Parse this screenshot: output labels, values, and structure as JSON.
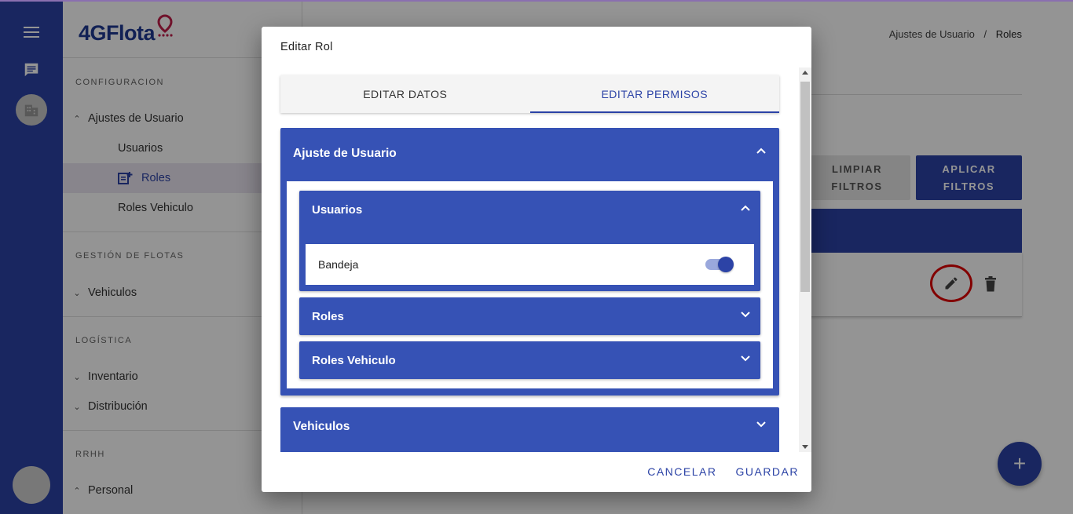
{
  "colors": {
    "primary": "#2c43a6",
    "panel": "#3652b5",
    "active_bg": "#ebe5f2",
    "highlight_ring": "#e00000"
  },
  "rail": {
    "icons": [
      "menu-icon",
      "chat-icon",
      "building-icon",
      "avatar"
    ]
  },
  "sidebar": {
    "logo": "4GFlota",
    "sections": {
      "config": "CONFIGURACION",
      "fleet": "GESTIÓN DE FLOTAS",
      "logistics": "LOGÍSTICA",
      "hr": "RRHH"
    },
    "items": {
      "ajustes": "Ajustes de Usuario",
      "usuarios": "Usuarios",
      "roles": "Roles",
      "roles_vehiculo": "Roles Vehiculo",
      "vehiculos": "Vehiculos",
      "inventario": "Inventario",
      "distribucion": "Distribución",
      "personal": "Personal"
    }
  },
  "main": {
    "breadcrumb": {
      "parent": "Ajustes de Usuario",
      "separator": "/",
      "current": "Roles"
    },
    "buttons": {
      "clear_line1": "LIMPIAR",
      "clear_line2": "FILTROS",
      "apply_line1": "APLICAR",
      "apply_line2": "FILTROS"
    },
    "fab": "+"
  },
  "dialog": {
    "title": "Editar Rol",
    "tabs": {
      "data": "EDITAR DATOS",
      "perms": "EDITAR PERMISOS"
    },
    "panels": {
      "ajuste": "Ajuste de Usuario",
      "usuarios": "Usuarios",
      "bandeja": "Bandeja",
      "roles": "Roles",
      "roles_vehiculo": "Roles Vehiculo",
      "vehiculos": "Vehiculos"
    },
    "toggle_on": true,
    "actions": {
      "cancel": "CANCELAR",
      "save": "GUARDAR"
    }
  }
}
